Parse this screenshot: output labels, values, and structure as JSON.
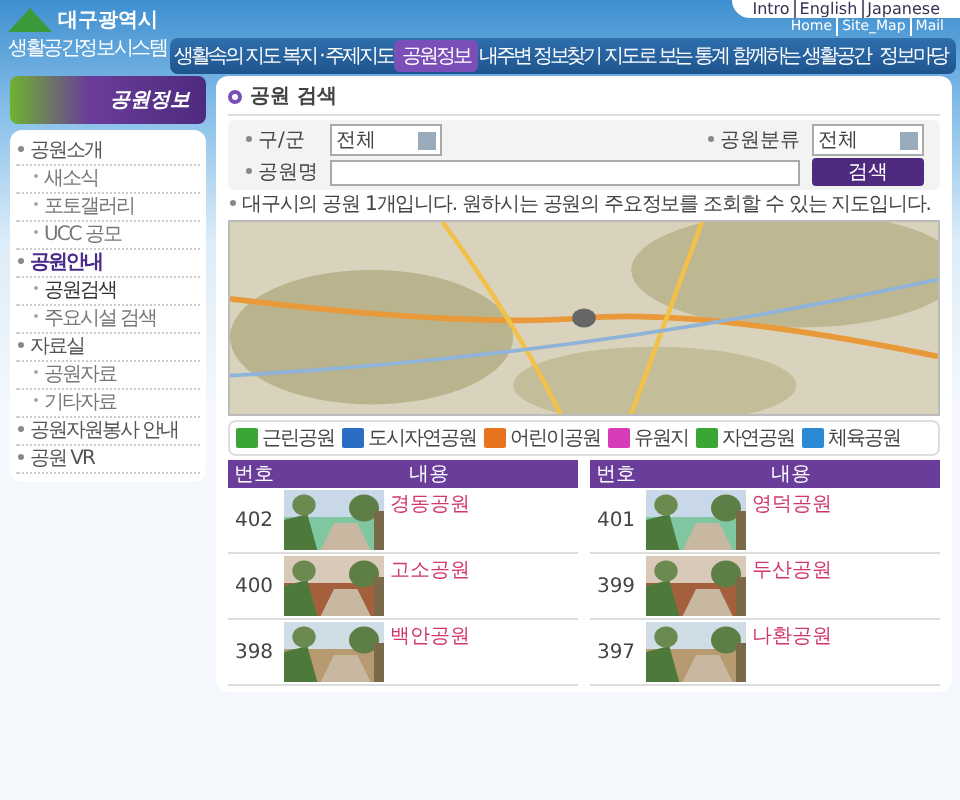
{
  "header": {
    "logo_city": "대구광역시",
    "logo_title": "생활공간정보시스템",
    "top_links": [
      "Intro",
      "English",
      "Japanese"
    ],
    "sub_links": [
      "Home",
      "Site_Map",
      "Mail"
    ]
  },
  "nav": [
    {
      "label": "생활속의 지도",
      "selected": false
    },
    {
      "label": "복지 · 주제지도",
      "selected": false
    },
    {
      "label": "공원정보",
      "selected": true
    },
    {
      "label": "내주변 정보찾기",
      "selected": false
    },
    {
      "label": "지도로 보는 통계",
      "selected": false
    },
    {
      "label": "함께하는 생활공간",
      "selected": false
    },
    {
      "label": "정보마당",
      "selected": false
    }
  ],
  "sidebar": {
    "title": "공원정보",
    "items": [
      {
        "label": "공원소개",
        "selected": false,
        "children": [
          {
            "label": "새소식",
            "selected": false
          },
          {
            "label": "포토갤러리",
            "selected": false
          },
          {
            "label": "UCC 공모",
            "selected": false
          }
        ]
      },
      {
        "label": "공원안내",
        "selected": true,
        "children": [
          {
            "label": "공원검색",
            "selected": true
          },
          {
            "label": "주요시설 검색",
            "selected": false
          }
        ]
      },
      {
        "label": "자료실",
        "selected": false,
        "children": [
          {
            "label": "공원자료",
            "selected": false
          },
          {
            "label": "기타자료",
            "selected": false
          }
        ]
      },
      {
        "label": "공원자원봉사 안내",
        "selected": false
      },
      {
        "label": "공원 VR",
        "selected": false
      }
    ]
  },
  "page_title": "공원 검색",
  "search": {
    "district_label": "구/군",
    "district_value": "전체",
    "category_label": "공원분류",
    "category_value": "전체",
    "name_label": "공원명",
    "button": "검색"
  },
  "note": "대구시의 공원 1개입니다. 원하시는 공원의 주요정보를 조회할 수 있는 지도입니다.",
  "legend": [
    {
      "label": "근린공원",
      "color": "#3aa635"
    },
    {
      "label": "도시자연공원",
      "color": "#2b6cc4"
    },
    {
      "label": "어린이공원",
      "color": "#e8731e"
    },
    {
      "label": "유원지",
      "color": "#d63cb8"
    },
    {
      "label": "자연공원",
      "color": "#3aa635"
    },
    {
      "label": "체육공원",
      "color": "#2b8ad6"
    }
  ],
  "tables": [
    {
      "columns": [
        "번호",
        "내용"
      ],
      "rows": [
        {
          "number": "402",
          "name": "경동공원"
        },
        {
          "number": "400",
          "name": "고소공원"
        },
        {
          "number": "398",
          "name": "백안공원"
        }
      ]
    },
    {
      "columns": [
        "번호",
        "내용"
      ],
      "rows": [
        {
          "number": "401",
          "name": "영덕공원"
        },
        {
          "number": "399",
          "name": "두산공원"
        },
        {
          "number": "397",
          "name": "나환공원"
        }
      ]
    }
  ]
}
